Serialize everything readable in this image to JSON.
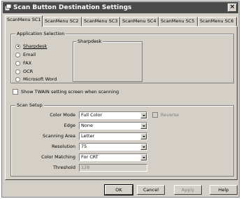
{
  "window": {
    "title": "Scan Button Destination Settings"
  },
  "tabs": [
    "ScanMenu SC1",
    "ScanMenu SC2",
    "ScanMenu SC3",
    "ScanMenu SC4",
    "ScanMenu SC5",
    "ScanMenu SC6"
  ],
  "application_selection": {
    "label": "Application Selection",
    "options": [
      "Sharpdesk",
      "Email",
      "FAX",
      "OCR",
      "Microsoft Word"
    ],
    "selected": "Sharpdesk",
    "app_box_label": "Sharpdesk"
  },
  "twain_checkbox": {
    "label": "Show TWAIN setting screen when scanning",
    "checked": false
  },
  "scan_setup": {
    "label": "Scan Setup",
    "color_mode": {
      "label": "Color Mode",
      "value": "Full Color"
    },
    "edge": {
      "label": "Edge",
      "value": "None"
    },
    "scanning_area": {
      "label": "Scanning Area",
      "value": "Letter"
    },
    "resolution": {
      "label": "Resolution",
      "value": "75"
    },
    "color_matching": {
      "label": "Color Matching",
      "value": "For CRT"
    },
    "threshold": {
      "label": "Threshold",
      "value": "128"
    },
    "reverse": {
      "label": "Reverse",
      "enabled": false
    }
  },
  "buttons": {
    "ok": "OK",
    "cancel": "Cancel",
    "apply": "Apply",
    "help": "Help"
  }
}
